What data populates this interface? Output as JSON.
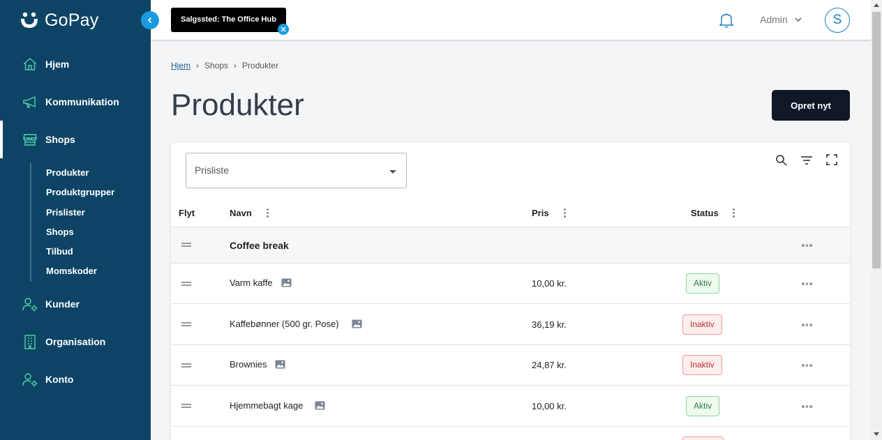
{
  "app": {
    "brand": "GoPay"
  },
  "sidebar": {
    "items": [
      {
        "label": "Hjem",
        "icon": "home-icon"
      },
      {
        "label": "Kommunikation",
        "icon": "megaphone-icon"
      },
      {
        "label": "Shops",
        "icon": "store-icon"
      },
      {
        "label": "Kunder",
        "icon": "users-gear-icon"
      },
      {
        "label": "Organisation",
        "icon": "building-icon"
      },
      {
        "label": "Konto",
        "icon": "user-gear-icon"
      }
    ],
    "sub_items": [
      "Produkter",
      "Produktgrupper",
      "Prislister",
      "Shops",
      "Tilbud",
      "Momskoder"
    ]
  },
  "topbar": {
    "store_tag": "Salgssted: The Office Hub",
    "user_menu": "Admin",
    "avatar_initial": "S"
  },
  "breadcrumb": {
    "items": [
      "Hjem",
      "Shops",
      "Produkter"
    ]
  },
  "page": {
    "title": "Produkter",
    "create_button": "Opret nyt"
  },
  "filter": {
    "placeholder": "Prisliste"
  },
  "table": {
    "columns": [
      "Flyt",
      "Navn",
      "Pris",
      "Status"
    ],
    "group": "Coffee break",
    "rows": [
      {
        "name": "Varm kaffe",
        "price": "10,00 kr.",
        "status": "Aktiv"
      },
      {
        "name": "Kaffebønner (500 gr. Pose)",
        "price": "36,19 kr.",
        "status": "Inaktiv"
      },
      {
        "name": "Brownies",
        "price": "24,87 kr.",
        "status": "Inaktiv"
      },
      {
        "name": "Hjemmebagt kage",
        "price": "10,00 kr.",
        "status": "Aktiv"
      }
    ]
  },
  "colors": {
    "sidebar": "#0d4466",
    "accent": "#1a9be0",
    "primary_button": "#101726"
  }
}
